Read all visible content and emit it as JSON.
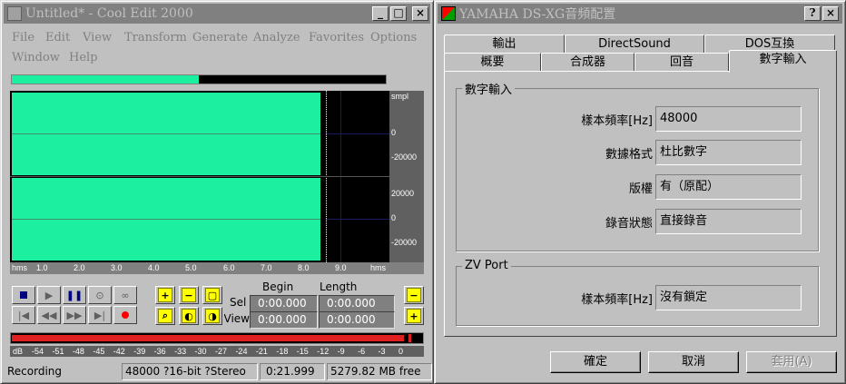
{
  "cooledit": {
    "title": "Untitled* - Cool Edit 2000",
    "menu": [
      "File",
      "Edit",
      "View",
      "Transform",
      "Generate",
      "Analyze",
      "Favorites",
      "Options",
      "Window",
      "Help"
    ],
    "overview_progress": 0.5,
    "units_top": "smpl",
    "scale_ch1": [
      "0",
      "-20000"
    ],
    "scale_ch2": [
      "20000",
      "0",
      "-20000"
    ],
    "time_unit": "hms",
    "time_ticks": [
      "1.0",
      "2.0",
      "3.0",
      "4.0",
      "5.0",
      "6.0",
      "7.0",
      "8.0",
      "9.0"
    ],
    "sel_headers": {
      "begin": "Begin",
      "length": "Length"
    },
    "sel_row_label": "Sel",
    "view_row_label": "View",
    "sel_begin": "0:00.000",
    "sel_length": "0:00.000",
    "view_begin": "0:00.000",
    "view_length": "0:00.000",
    "db_unit": "dB",
    "db_ticks": [
      "-54",
      "-51",
      "-48",
      "-45",
      "-42",
      "-39",
      "-36",
      "-33",
      "-30",
      "-27",
      "-24",
      "-21",
      "-18",
      "-15",
      "-12",
      "-9",
      "-6",
      "-3",
      "0"
    ],
    "status": {
      "state": "Recording",
      "format": "48000 ?16-bit ?Stereo",
      "time": "0:21.999",
      "free": "5279.82 MB free"
    }
  },
  "yamaha": {
    "title": "YAMAHA DS-XG音頻配置",
    "tabs_row1": [
      "輸出",
      "DirectSound",
      "DOS互換"
    ],
    "tabs_row2": [
      "概要",
      "合成器",
      "回音",
      "數字輸入"
    ],
    "group1": {
      "title": "數字輸入",
      "rows": [
        {
          "label": "樣本頻率[Hz]",
          "value": "48000"
        },
        {
          "label": "數據格式",
          "value": "杜比數字"
        },
        {
          "label": "版權",
          "value": "有（原配）"
        },
        {
          "label": "錄音狀態",
          "value": "直接錄音"
        }
      ]
    },
    "group2": {
      "title": "ZV Port",
      "rows": [
        {
          "label": "樣本頻率[Hz]",
          "value": "沒有鎖定"
        }
      ]
    },
    "buttons": {
      "ok": "確定",
      "cancel": "取消",
      "apply": "套用(A)"
    }
  }
}
